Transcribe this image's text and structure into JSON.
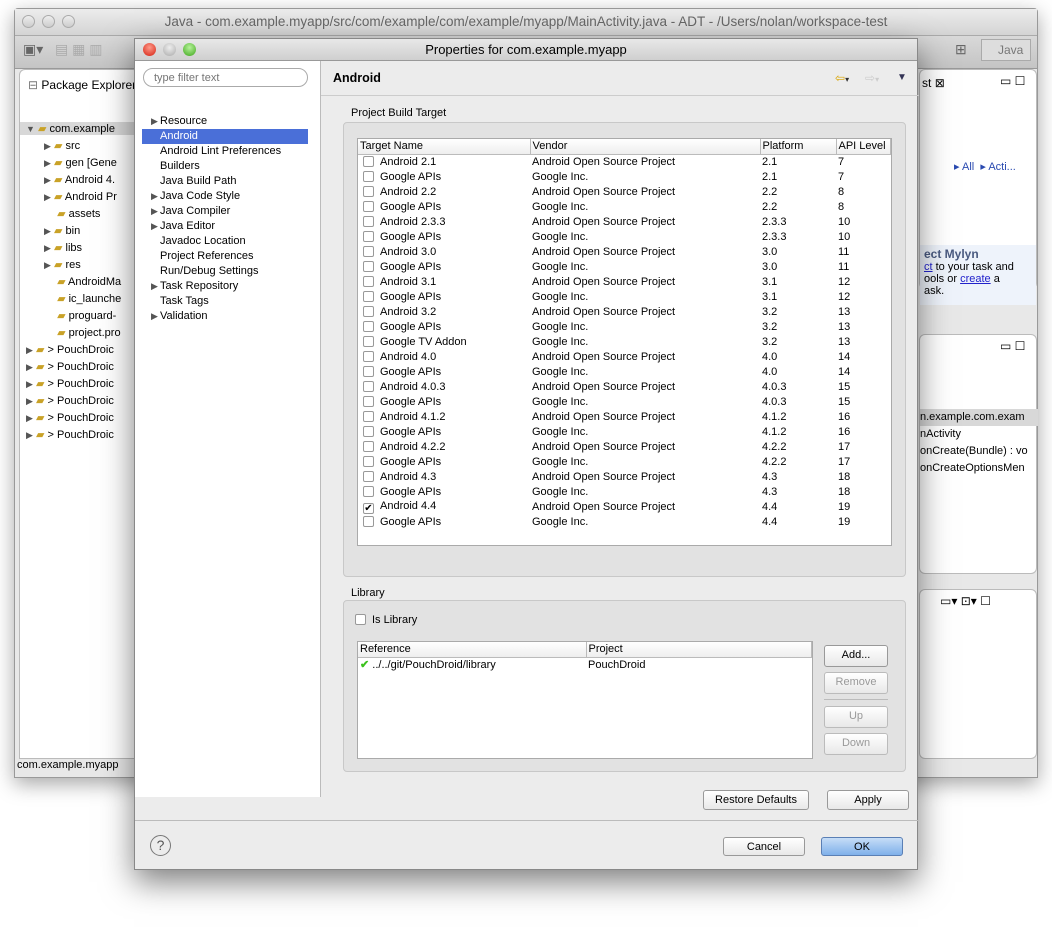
{
  "background_window": {
    "title": "Java - com.example.myapp/src/com/example/com/example/myapp/MainActivity.java - ADT - /Users/nolan/workspace-test",
    "perspective": "Java",
    "package_explorer": {
      "title": "Package Explorer",
      "items": [
        {
          "label": "com.example",
          "indent": 0,
          "expanded": true
        },
        {
          "label": "src",
          "indent": 1
        },
        {
          "label": "gen [Gene",
          "indent": 1
        },
        {
          "label": "Android 4.",
          "indent": 1
        },
        {
          "label": "Android Pr",
          "indent": 1
        },
        {
          "label": "assets",
          "indent": 1,
          "leaf": true
        },
        {
          "label": "bin",
          "indent": 1
        },
        {
          "label": "libs",
          "indent": 1
        },
        {
          "label": "res",
          "indent": 1
        },
        {
          "label": "AndroidMa",
          "indent": 1,
          "leaf": true
        },
        {
          "label": "ic_launche",
          "indent": 1,
          "leaf": true
        },
        {
          "label": "proguard-",
          "indent": 1,
          "leaf": true
        },
        {
          "label": "project.pro",
          "indent": 1,
          "leaf": true
        },
        {
          "label": "> PouchDroic",
          "indent": 0
        },
        {
          "label": "> PouchDroic",
          "indent": 0
        },
        {
          "label": "> PouchDroic",
          "indent": 0
        },
        {
          "label": "> PouchDroic",
          "indent": 0
        },
        {
          "label": "> PouchDroic",
          "indent": 0
        },
        {
          "label": "> PouchDroic",
          "indent": 0
        }
      ]
    },
    "status_text": "com.example.myapp",
    "task_list": {
      "tab_fragment": "st",
      "all": "All",
      "activate": "Acti..."
    },
    "mylyn": {
      "title": "ect Mylyn",
      "line1_link": "ct",
      "line1_rest": " to your task and",
      "line2_pre": "ools or ",
      "line2_link": "create",
      "line2_rest": " a",
      "line3": "ask."
    },
    "outline": {
      "items": [
        "n.example.com.exam",
        "nActivity",
        "onCreate(Bundle) : vo",
        "onCreateOptionsMen"
      ]
    }
  },
  "dialog": {
    "title": "Properties for com.example.myapp",
    "filter_placeholder": "type filter text",
    "nav": [
      {
        "label": "Resource",
        "expandable": true
      },
      {
        "label": "Android",
        "selected": true
      },
      {
        "label": "Android Lint Preferences"
      },
      {
        "label": "Builders"
      },
      {
        "label": "Java Build Path"
      },
      {
        "label": "Java Code Style",
        "expandable": true
      },
      {
        "label": "Java Compiler",
        "expandable": true
      },
      {
        "label": "Java Editor",
        "expandable": true
      },
      {
        "label": "Javadoc Location"
      },
      {
        "label": "Project References"
      },
      {
        "label": "Run/Debug Settings"
      },
      {
        "label": "Task Repository",
        "expandable": true
      },
      {
        "label": "Task Tags"
      },
      {
        "label": "Validation",
        "expandable": true
      }
    ],
    "page_title": "Android",
    "build_target": {
      "group_label": "Project Build Target",
      "columns": [
        "Target Name",
        "Vendor",
        "Platform",
        "API Level"
      ],
      "rows": [
        {
          "name": "Android 2.1",
          "vendor": "Android Open Source Project",
          "platform": "2.1",
          "api": "7",
          "checked": false
        },
        {
          "name": "Google APIs",
          "vendor": "Google Inc.",
          "platform": "2.1",
          "api": "7",
          "checked": false
        },
        {
          "name": "Android 2.2",
          "vendor": "Android Open Source Project",
          "platform": "2.2",
          "api": "8",
          "checked": false
        },
        {
          "name": "Google APIs",
          "vendor": "Google Inc.",
          "platform": "2.2",
          "api": "8",
          "checked": false
        },
        {
          "name": "Android 2.3.3",
          "vendor": "Android Open Source Project",
          "platform": "2.3.3",
          "api": "10",
          "checked": false
        },
        {
          "name": "Google APIs",
          "vendor": "Google Inc.",
          "platform": "2.3.3",
          "api": "10",
          "checked": false
        },
        {
          "name": "Android 3.0",
          "vendor": "Android Open Source Project",
          "platform": "3.0",
          "api": "11",
          "checked": false
        },
        {
          "name": "Google APIs",
          "vendor": "Google Inc.",
          "platform": "3.0",
          "api": "11",
          "checked": false
        },
        {
          "name": "Android 3.1",
          "vendor": "Android Open Source Project",
          "platform": "3.1",
          "api": "12",
          "checked": false
        },
        {
          "name": "Google APIs",
          "vendor": "Google Inc.",
          "platform": "3.1",
          "api": "12",
          "checked": false
        },
        {
          "name": "Android 3.2",
          "vendor": "Android Open Source Project",
          "platform": "3.2",
          "api": "13",
          "checked": false
        },
        {
          "name": "Google APIs",
          "vendor": "Google Inc.",
          "platform": "3.2",
          "api": "13",
          "checked": false
        },
        {
          "name": "Google TV Addon",
          "vendor": "Google Inc.",
          "platform": "3.2",
          "api": "13",
          "checked": false
        },
        {
          "name": "Android 4.0",
          "vendor": "Android Open Source Project",
          "platform": "4.0",
          "api": "14",
          "checked": false
        },
        {
          "name": "Google APIs",
          "vendor": "Google Inc.",
          "platform": "4.0",
          "api": "14",
          "checked": false
        },
        {
          "name": "Android 4.0.3",
          "vendor": "Android Open Source Project",
          "platform": "4.0.3",
          "api": "15",
          "checked": false
        },
        {
          "name": "Google APIs",
          "vendor": "Google Inc.",
          "platform": "4.0.3",
          "api": "15",
          "checked": false
        },
        {
          "name": "Android 4.1.2",
          "vendor": "Android Open Source Project",
          "platform": "4.1.2",
          "api": "16",
          "checked": false
        },
        {
          "name": "Google APIs",
          "vendor": "Google Inc.",
          "platform": "4.1.2",
          "api": "16",
          "checked": false
        },
        {
          "name": "Android 4.2.2",
          "vendor": "Android Open Source Project",
          "platform": "4.2.2",
          "api": "17",
          "checked": false
        },
        {
          "name": "Google APIs",
          "vendor": "Google Inc.",
          "platform": "4.2.2",
          "api": "17",
          "checked": false
        },
        {
          "name": "Android 4.3",
          "vendor": "Android Open Source Project",
          "platform": "4.3",
          "api": "18",
          "checked": false
        },
        {
          "name": "Google APIs",
          "vendor": "Google Inc.",
          "platform": "4.3",
          "api": "18",
          "checked": false
        },
        {
          "name": "Android 4.4",
          "vendor": "Android Open Source Project",
          "platform": "4.4",
          "api": "19",
          "checked": true
        },
        {
          "name": "Google APIs",
          "vendor": "Google Inc.",
          "platform": "4.4",
          "api": "19",
          "checked": false
        }
      ]
    },
    "library": {
      "group_label": "Library",
      "is_library_label": "Is Library",
      "is_library": false,
      "columns": [
        "Reference",
        "Project"
      ],
      "rows": [
        {
          "reference": "../../git/PouchDroid/library",
          "project": "PouchDroid",
          "status": "ok"
        }
      ],
      "buttons": {
        "add": "Add...",
        "remove": "Remove",
        "up": "Up",
        "down": "Down"
      }
    },
    "buttons": {
      "restore_defaults": "Restore Defaults",
      "apply": "Apply",
      "cancel": "Cancel",
      "ok": "OK"
    },
    "colors": {
      "selection": "#4a6fd8",
      "ok_button": "#7fb0ea",
      "check": "#3cc21e"
    }
  }
}
